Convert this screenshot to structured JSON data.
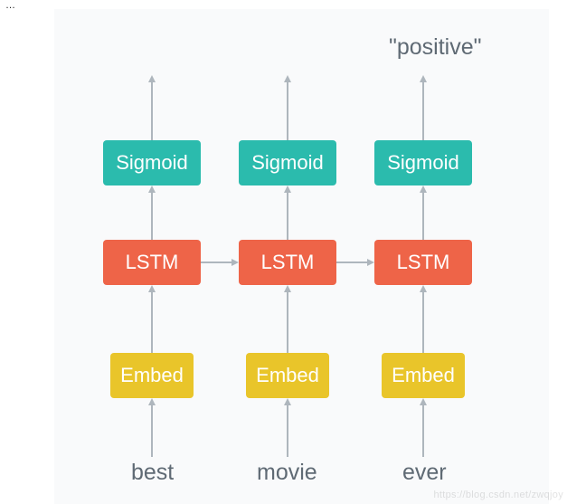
{
  "fragment_text": "…",
  "watermark": "https://blog.csdn.net/zwqjoy",
  "output_label": "\"positive\"",
  "columns": [
    {
      "input": "best",
      "embed": "Embed",
      "lstm": "LSTM",
      "sigmoid": "Sigmoid"
    },
    {
      "input": "movie",
      "embed": "Embed",
      "lstm": "LSTM",
      "sigmoid": "Sigmoid"
    },
    {
      "input": "ever",
      "embed": "Embed",
      "lstm": "LSTM",
      "sigmoid": "Sigmoid"
    }
  ],
  "colors": {
    "sigmoid": "#2bbbad",
    "lstm": "#ee6448",
    "embed": "#e9c52a",
    "arrow": "#aeb6bd",
    "text": "#5f6a74",
    "canvas_bg": "#f9fafb"
  },
  "chart_data": {
    "type": "diagram",
    "title": "",
    "description": "Unrolled RNN for sentiment classification. Each input word is embedded, passed through a shared LSTM that also receives the previous time step's hidden state, then through a Sigmoid layer. The final output at the last time step is the label \"positive\".",
    "time_steps": 3,
    "inputs": [
      "best",
      "movie",
      "ever"
    ],
    "layers_bottom_to_top": [
      "Embed",
      "LSTM",
      "Sigmoid"
    ],
    "horizontal_connections": [
      {
        "from": "LSTM@t1",
        "to": "LSTM@t2"
      },
      {
        "from": "LSTM@t2",
        "to": "LSTM@t3"
      }
    ],
    "vertical_connections_per_step": [
      "input->Embed",
      "Embed->LSTM",
      "LSTM->Sigmoid",
      "Sigmoid->output"
    ],
    "final_output": "positive"
  }
}
